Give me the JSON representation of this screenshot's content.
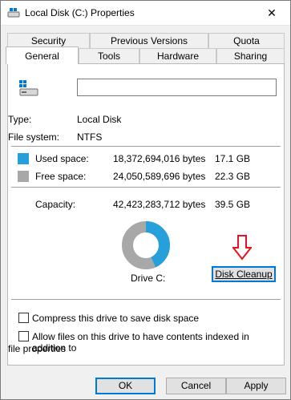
{
  "window": {
    "title": "Local Disk (C:) Properties",
    "close_glyph": "✕"
  },
  "tabs": {
    "row1": [
      "Security",
      "Previous Versions",
      "Quota"
    ],
    "row2": [
      "General",
      "Tools",
      "Hardware",
      "Sharing"
    ],
    "active": "General"
  },
  "general": {
    "name_value": "",
    "type_label": "Type:",
    "type_value": "Local Disk",
    "fs_label": "File system:",
    "fs_value": "NTFS",
    "used_label": "Used space:",
    "used_bytes": "18,372,694,016 bytes",
    "used_size": "17.1 GB",
    "free_label": "Free space:",
    "free_bytes": "24,050,589,696 bytes",
    "free_size": "22.3 GB",
    "capacity_label": "Capacity:",
    "capacity_bytes": "42,423,283,712 bytes",
    "capacity_size": "39.5 GB",
    "drive_label": "Drive C:",
    "used_fraction": 0.433,
    "cleanup_button": "Disk Cleanup",
    "compress_label": "Compress this drive to save disk space",
    "index_label_line1": "Allow files on this drive to have contents indexed in addition to",
    "index_label_line2": "file properties"
  },
  "colors": {
    "used": "#26a0da",
    "free": "#a8a8a8",
    "arrow": "#e81123",
    "accent": "#0078d7"
  },
  "buttons": {
    "ok": "OK",
    "cancel": "Cancel",
    "apply": "Apply"
  }
}
